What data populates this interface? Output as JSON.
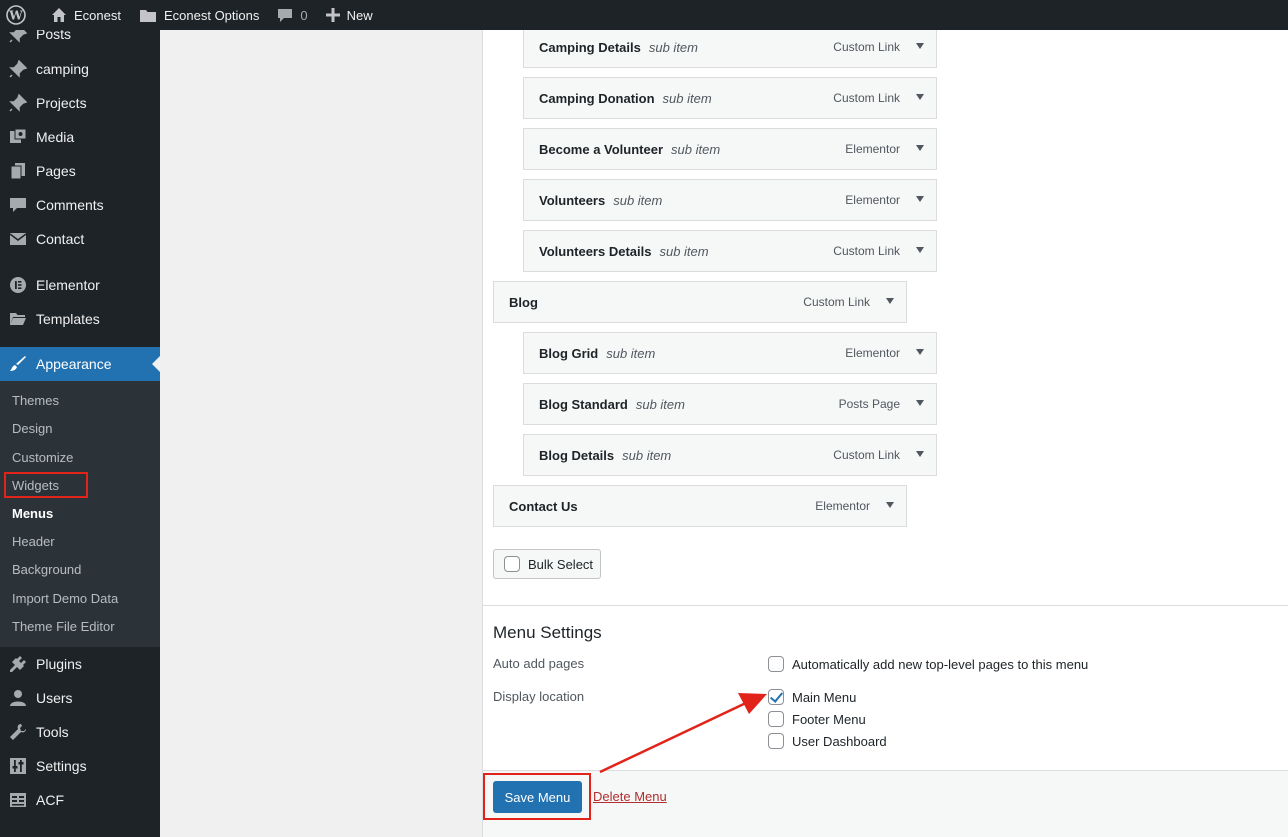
{
  "admin_bar": {
    "site_name": "Econest",
    "options_label": "Econest Options",
    "comments_count": "0",
    "new_label": "New"
  },
  "sidebar": {
    "items": [
      {
        "label": "Posts",
        "icon": "pin-icon"
      },
      {
        "label": "camping",
        "icon": "pin-icon"
      },
      {
        "label": "Projects",
        "icon": "pin-icon"
      },
      {
        "label": "Media",
        "icon": "media-icon"
      },
      {
        "label": "Pages",
        "icon": "pages-icon"
      },
      {
        "label": "Comments",
        "icon": "comment-icon"
      },
      {
        "label": "Contact",
        "icon": "mail-icon"
      },
      {
        "label": "Elementor",
        "icon": "elementor-icon"
      },
      {
        "label": "Templates",
        "icon": "folder-icon"
      },
      {
        "label": "Appearance",
        "icon": "brush-icon"
      },
      {
        "label": "Plugins",
        "icon": "plugin-icon"
      },
      {
        "label": "Users",
        "icon": "user-icon"
      },
      {
        "label": "Tools",
        "icon": "wrench-icon"
      },
      {
        "label": "Settings",
        "icon": "settings-icon"
      },
      {
        "label": "ACF",
        "icon": "acf-icon"
      }
    ],
    "submenu": [
      "Themes",
      "Design",
      "Customize",
      "Widgets",
      "Menus",
      "Header",
      "Background",
      "Import Demo Data",
      "Theme File Editor"
    ]
  },
  "menu_items": [
    {
      "title": "Camping Details",
      "sub": "sub item",
      "type": "Custom Link"
    },
    {
      "title": "Camping Donation",
      "sub": "sub item",
      "type": "Custom Link"
    },
    {
      "title": "Become a Volunteer",
      "sub": "sub item",
      "type": "Elementor"
    },
    {
      "title": "Volunteers",
      "sub": "sub item",
      "type": "Elementor"
    },
    {
      "title": "Volunteers Details",
      "sub": "sub item",
      "type": "Custom Link"
    },
    {
      "title": "Blog",
      "sub": "",
      "type": "Custom Link"
    },
    {
      "title": "Blog Grid",
      "sub": "sub item",
      "type": "Elementor"
    },
    {
      "title": "Blog Standard",
      "sub": "sub item",
      "type": "Posts Page"
    },
    {
      "title": "Blog Details",
      "sub": "sub item",
      "type": "Custom Link"
    },
    {
      "title": "Contact Us",
      "sub": "",
      "type": "Elementor"
    }
  ],
  "bulk_select_label": "Bulk Select",
  "settings": {
    "title": "Menu Settings",
    "auto_add_label": "Auto add pages",
    "auto_add_option": "Automatically add new top-level pages to this menu",
    "display_location_label": "Display location",
    "locations": [
      {
        "label": "Main Menu",
        "checked": true
      },
      {
        "label": "Footer Menu",
        "checked": false
      },
      {
        "label": "User Dashboard",
        "checked": false
      }
    ]
  },
  "actions": {
    "save_label": "Save Menu",
    "delete_label": "Delete Menu"
  },
  "colors": {
    "accent": "#2271b1",
    "highlight": "#e2231a"
  }
}
